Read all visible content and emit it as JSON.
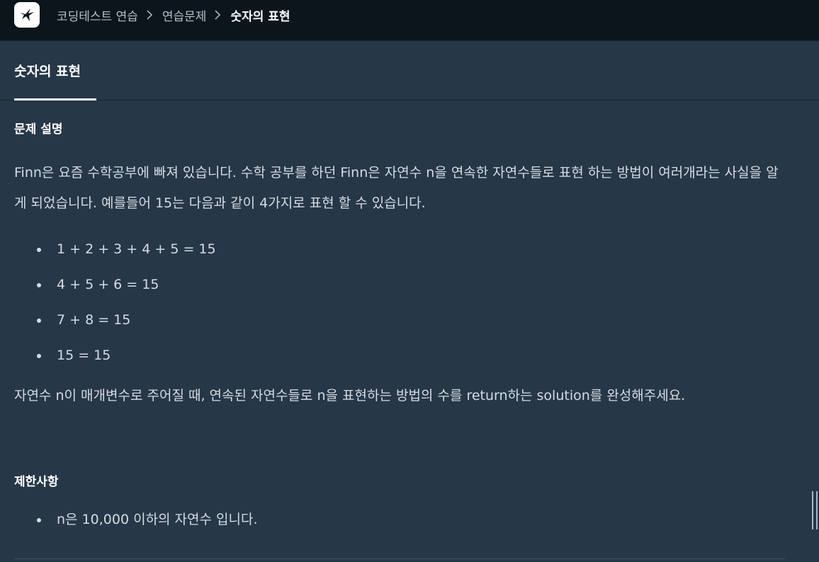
{
  "header": {
    "logo_icon": "bird-logo-icon",
    "breadcrumb": [
      "코딩테스트 연습",
      "연습문제",
      "숫자의 표현"
    ],
    "separator_icon": "chevron-right-icon"
  },
  "tabs": [
    {
      "label": "숫자의 표현",
      "active": true
    }
  ],
  "problem": {
    "description_heading": "문제 설명",
    "intro": "Finn은 요즘 수학공부에 빠져 있습니다. 수학 공부를 하던 Finn은 자연수 n을 연속한 자연수들로 표현 하는 방법이 여러개라는 사실을 알게 되었습니다. 예를들어 15는 다음과 같이 4가지로 표현 할 수 있습니다.",
    "examples": [
      "1 + 2 + 3 + 4 + 5 = 15",
      "4 + 5 + 6 = 15",
      "7 + 8 = 15",
      "15 = 15"
    ],
    "task": "자연수 n이 매개변수로 주어질 때, 연속된 자연수들로 n을 표현하는 방법의 수를 return하는 solution를 완성해주세요.",
    "limits_heading": "제한사항",
    "limits": [
      "n은 10,000 이하의 자연수 입니다."
    ]
  },
  "colors": {
    "page_bg": "#263747",
    "topbar_bg": "#0c151c",
    "text": "#d5dce3",
    "heading": "#ffffff"
  }
}
